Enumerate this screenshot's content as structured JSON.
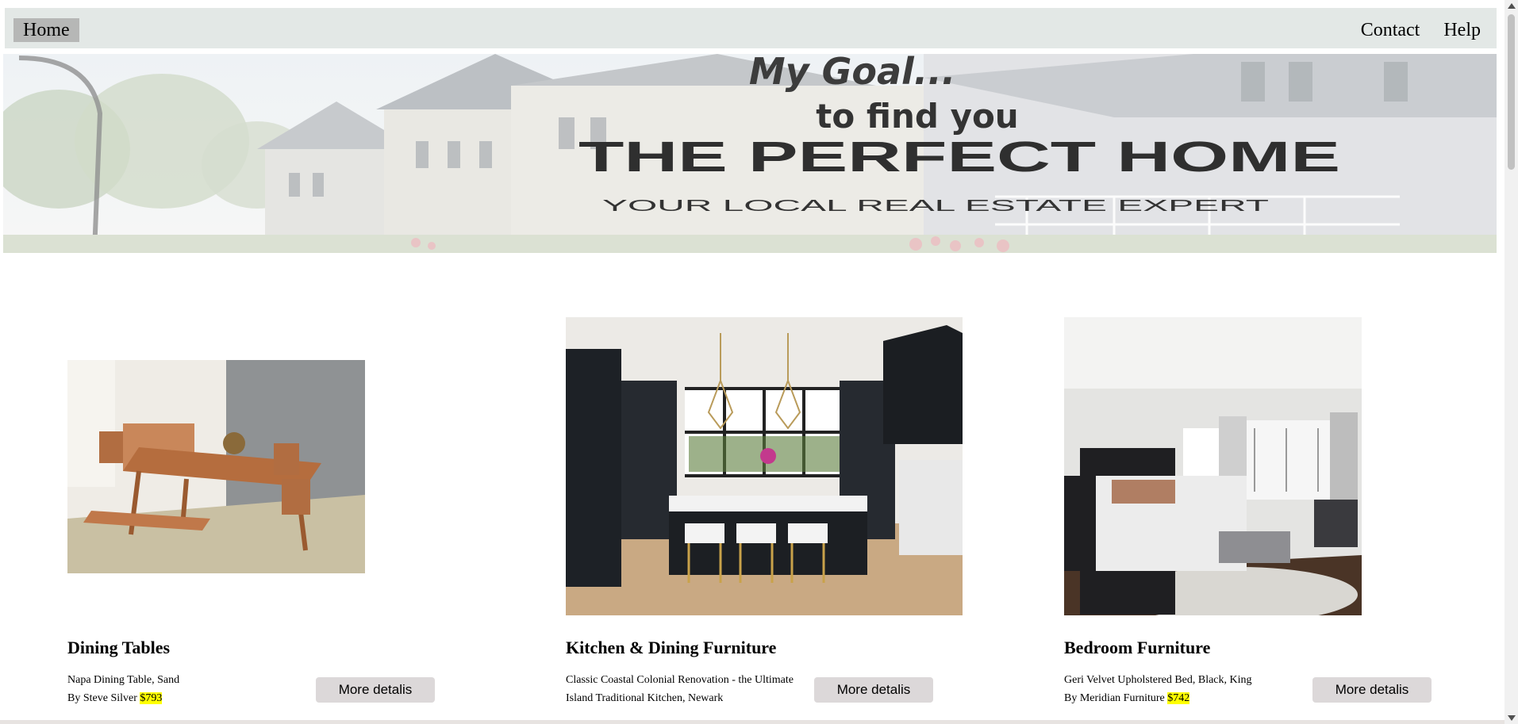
{
  "nav": {
    "home_label": "Home",
    "contact_label": "Contact",
    "help_label": "Help"
  },
  "hero": {
    "line1": "My Goal...",
    "line2": "to find you",
    "line3": "THE PERFECT HOME",
    "line4": "YOUR LOCAL REAL ESTATE EXPERT"
  },
  "products": [
    {
      "title": "Dining Tables",
      "desc_line1": "Napa Dining Table, Sand",
      "desc_line2": "By Steve Silver",
      "price": "$793",
      "button": "More detalis"
    },
    {
      "title": "Kitchen & Dining Furniture",
      "desc_line1": "Classic Coastal Colonial Renovation - the Ultimate",
      "desc_line2": "Island Traditional Kitchen, Newark",
      "price": "",
      "button": "More detalis"
    },
    {
      "title": "Bedroom Furniture",
      "desc_line1": "Geri Velvet Upholstered Bed, Black, King",
      "desc_line2": "By Meridian Furniture",
      "price": "$742",
      "button": "More detalis"
    }
  ],
  "colors": {
    "nav_bg": "#e3e8e6",
    "home_highlight": "#b6b7b6",
    "button_bg": "#dcd8d9",
    "price_highlight": "#ffff00"
  }
}
